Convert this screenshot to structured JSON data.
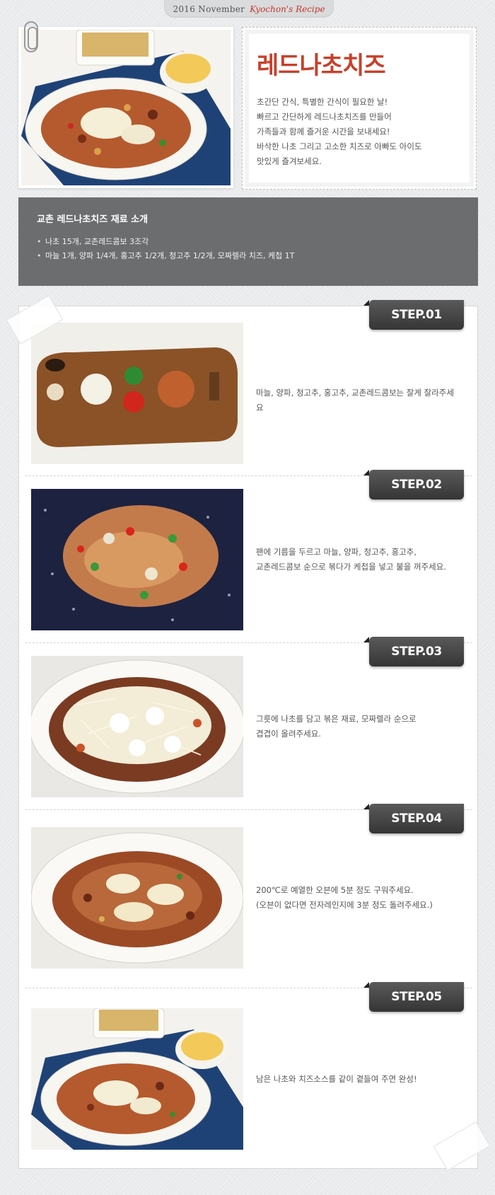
{
  "header": {
    "date_label": "2016 November",
    "brand_label": "Kyochon's Recipe"
  },
  "intro": {
    "title": "레드나초치즈",
    "lines": [
      "초간단 간식, 특별한 간식이 필요한 날!",
      "빠르고 간단하게 레드나초치즈를 만들어",
      "가족들과 함께 즐거운 시간을 보내세요!",
      "바삭한 나초 그리고 고소한 치즈로 아빠도 아이도",
      "맛있게 즐겨보세요."
    ]
  },
  "ingredients": {
    "title": "교촌 레드나초치즈 재료 소개",
    "items": [
      "나초 15개, 교촌레드콤보 3조각",
      "마늘 1개, 양파 1/4개, 홍고추 1/2개, 청고추 1/2개, 모짜렐라 치즈, 케첩 1T"
    ]
  },
  "steps": [
    {
      "badge": "STEP.01",
      "lines": [
        "마늘, 양파, 청고추, 홍고추, 교촌레드콤보는 잘게 잘라주세요"
      ]
    },
    {
      "badge": "STEP.02",
      "lines": [
        "팬에 기름을 두르고 마늘, 양파, 청고추, 홍고추,",
        "교촌레드콤보 순으로 볶다가 케첩을 넣고 불을 꺼주세요."
      ]
    },
    {
      "badge": "STEP.03",
      "lines": [
        "그릇에 나초를 담고 볶은 재료, 모짜렐라 순으로",
        "겹겹이 올려주세요."
      ]
    },
    {
      "badge": "STEP.04",
      "lines": [
        "200℃로 예열한 오븐에 5분 정도 구워주세요.",
        "(오븐이 없다면 전자레인지에 3분 정도 돌려주세요.)"
      ]
    },
    {
      "badge": "STEP.05",
      "lines": [
        "남은 나초와 치즈소스를 같이 곁들여 주면 완성!"
      ]
    }
  ]
}
